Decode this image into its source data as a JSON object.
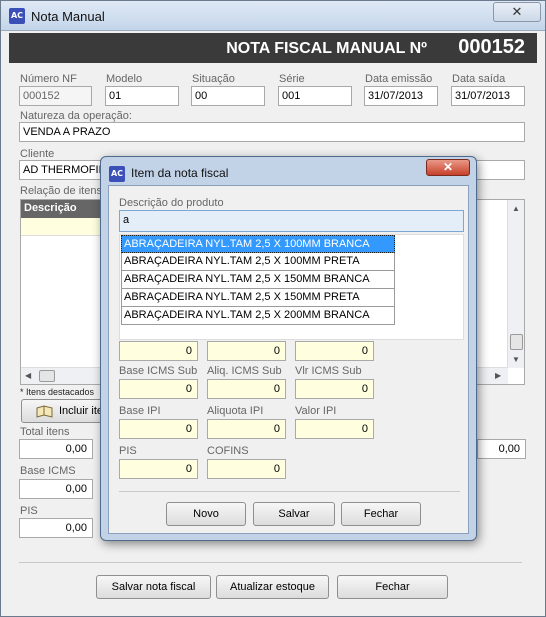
{
  "window": {
    "title": "Nota Manual",
    "close_glyph": "✕",
    "icon_text": "AC"
  },
  "header": {
    "label": "NOTA FISCAL MANUAL Nº",
    "number": "000152"
  },
  "fields": {
    "numero_nf": {
      "label": "Número NF",
      "value": "000152"
    },
    "modelo": {
      "label": "Modelo",
      "value": "01"
    },
    "situacao": {
      "label": "Situação",
      "value": "00"
    },
    "serie": {
      "label": "Série",
      "value": "001"
    },
    "data_emissao": {
      "label": "Data emissão",
      "value": "31/07/2013"
    },
    "data_saida": {
      "label": "Data saída",
      "value": "31/07/2013"
    },
    "natureza": {
      "label": "Natureza da operação:",
      "value": "VENDA  A PRAZO"
    },
    "cliente": {
      "label": "Cliente",
      "value": "AD THERMOFILM"
    }
  },
  "items": {
    "label": "Relação de itens",
    "column_descricao": "Descrição",
    "note": "* Itens destacados",
    "include_button": "Incluir itens"
  },
  "totals": {
    "total_itens": {
      "label": "Total itens",
      "value": "0,00"
    },
    "base_icms": {
      "label": "Base ICMS",
      "value": "0,00"
    },
    "pis": {
      "label": "PIS",
      "value": "0,00"
    },
    "right_value": "0,00"
  },
  "footer_buttons": {
    "salvar": "Salvar nota fiscal",
    "atualizar": "Atualizar estoque",
    "fechar": "Fechar"
  },
  "dialog": {
    "title": "Item da nota fiscal",
    "icon_text": "AC",
    "close_glyph": "✕",
    "descricao_label": "Descrição do produto",
    "descricao_value": "a",
    "suggestions": [
      "ABRAÇADEIRA NYL.TAM 2,5 X 100MM BRANCA",
      "ABRAÇADEIRA NYL.TAM 2,5 X 100MM PRETA",
      "ABRAÇADEIRA NYL.TAM 2,5 X 150MM BRANCA",
      "ABRAÇADEIRA NYL.TAM 2,5 X 150MM PRETA",
      "ABRAÇADEIRA NYL.TAM 2,5 X 200MM BRANCA"
    ],
    "selected_index": 0,
    "row1": [
      "0",
      "0",
      "0"
    ],
    "base_icms_sub": {
      "label": "Base ICMS Sub",
      "value": "0"
    },
    "aliq_icms_sub": {
      "label": "Aliq. ICMS Sub",
      "value": "0"
    },
    "vlr_icms_sub": {
      "label": "Vlr ICMS Sub",
      "value": "0"
    },
    "base_ipi": {
      "label": "Base IPI",
      "value": "0"
    },
    "aliquota_ipi": {
      "label": "Aliquota IPI",
      "value": "0"
    },
    "valor_ipi": {
      "label": "Valor IPI",
      "value": "0"
    },
    "pis": {
      "label": "PIS",
      "value": "0"
    },
    "cofins": {
      "label": "COFINS",
      "value": "0"
    },
    "buttons": {
      "novo": "Novo",
      "salvar": "Salvar",
      "fechar": "Fechar"
    }
  }
}
